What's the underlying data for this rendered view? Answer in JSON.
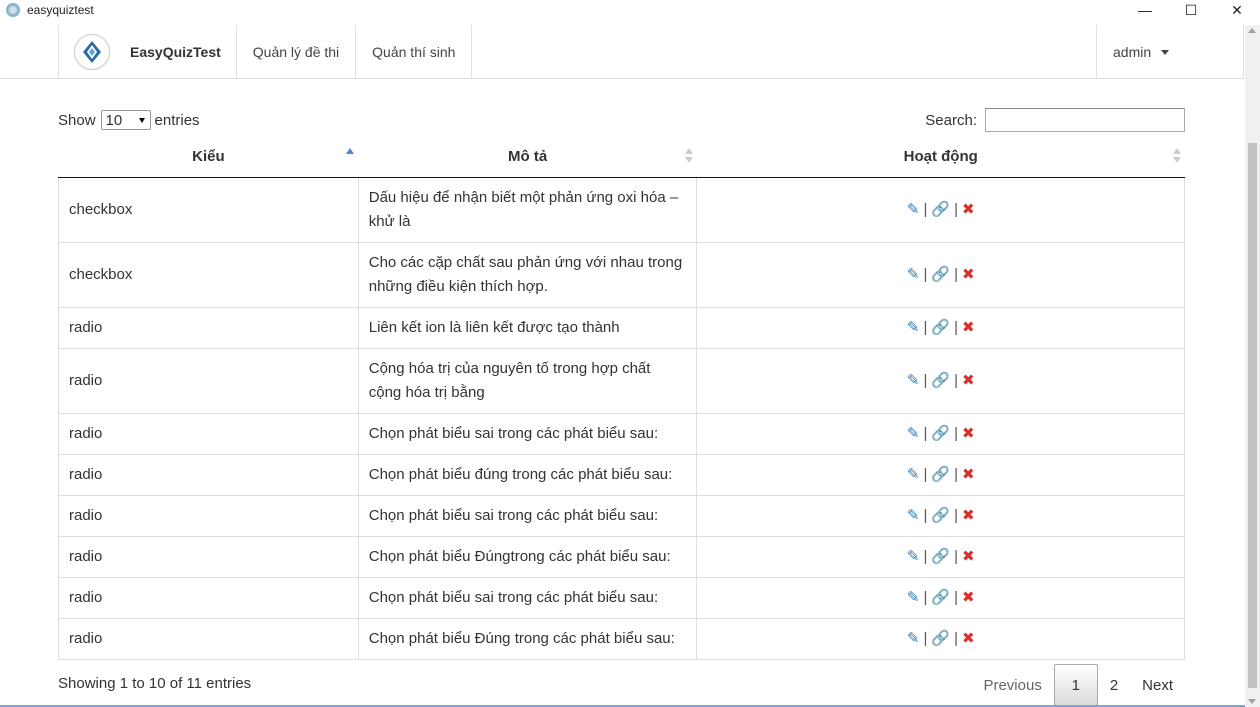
{
  "window": {
    "title": "easyquiztest",
    "minimize": "—",
    "maximize": "☐",
    "close": "✕"
  },
  "navbar": {
    "brand": "EasyQuizTest",
    "links": [
      "Quản lý đề thi",
      "Quản thí sinh"
    ],
    "user": "admin"
  },
  "length": {
    "show": "Show",
    "value": "10",
    "entries": "entries"
  },
  "search": {
    "label": "Search:",
    "value": ""
  },
  "table": {
    "headers": [
      "Kiểu",
      "Mô tả",
      "Hoạt động"
    ],
    "rows": [
      {
        "type": "checkbox",
        "desc": "Dấu hiệu để nhận biết một phản ứng oxi hóa – khử là"
      },
      {
        "type": "checkbox",
        "desc": "Cho các cặp chất sau phản ứng với nhau trong những điều kiện thích hợp."
      },
      {
        "type": "radio",
        "desc": "Liên kết ion là liên kết được tạo thành"
      },
      {
        "type": "radio",
        "desc": "Cộng hóa trị của nguyên tố trong hợp chất cộng hóa trị bằng"
      },
      {
        "type": "radio",
        "desc": "Chọn phát biểu sai trong các phát biểu sau:"
      },
      {
        "type": "radio",
        "desc": "Chọn phát biểu đúng trong các phát biểu sau:"
      },
      {
        "type": "radio",
        "desc": "Chọn phát biểu sai trong các phát biểu sau:"
      },
      {
        "type": "radio",
        "desc": "Chọn phát biểu Đúngtrong các phát biểu sau:"
      },
      {
        "type": "radio",
        "desc": "Chọn phát biểu sai trong các phát biểu sau:"
      },
      {
        "type": "radio",
        "desc": "Chọn phát biểu Đúng trong các phát biểu sau:"
      }
    ],
    "action_sep": "|"
  },
  "footer": {
    "info": "Showing 1 to 10 of 11 entries",
    "previous": "Previous",
    "pages": [
      "1",
      "2"
    ],
    "current_page": "1",
    "next": "Next"
  },
  "colors": {
    "edit": "#337ab7",
    "link": "#f0901c",
    "delete": "#d9302c",
    "accent": "#7aa7d6"
  }
}
